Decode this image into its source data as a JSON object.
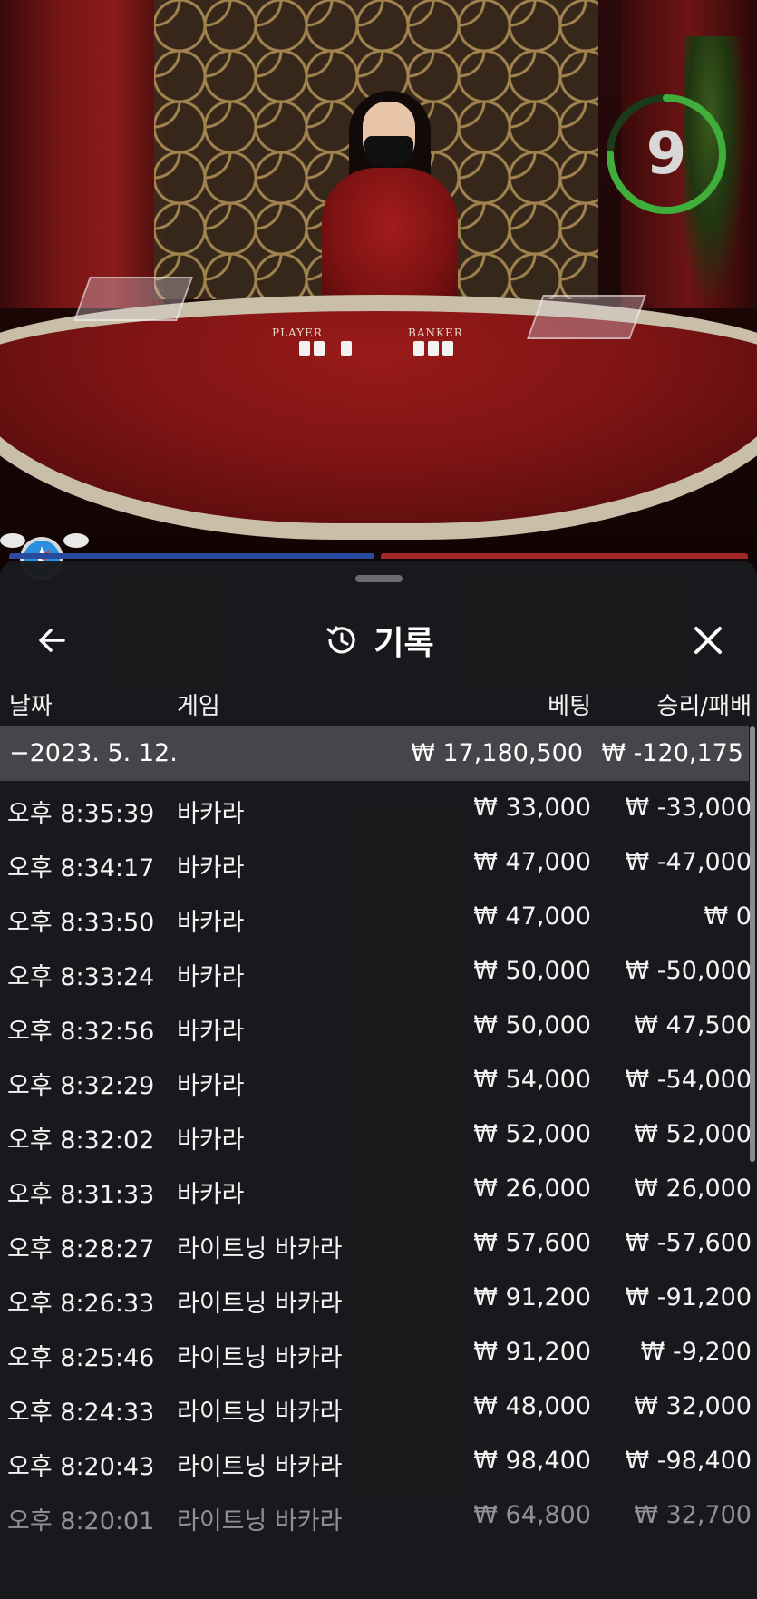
{
  "timer": {
    "value": "9",
    "fraction_remaining": 0.75,
    "color": "#3fae3a"
  },
  "table_labels": {
    "player": "PLAYER",
    "banker": "BANKER"
  },
  "header": {
    "title": "기록",
    "history_icon": "history-icon",
    "back_icon": "arrow-left-icon",
    "close_icon": "close-icon"
  },
  "columns": {
    "date": "날짜",
    "game": "게임",
    "bet": "베팅",
    "result": "승리/패배"
  },
  "summary": {
    "date": "−2023. 5. 12.",
    "bet": "₩ 17,180,500",
    "result": "₩ -120,175"
  },
  "rows": [
    {
      "time": "오후 8:35:39",
      "game": "바카라",
      "bet": "₩ 33,000",
      "result": "₩ -33,000"
    },
    {
      "time": "오후 8:34:17",
      "game": "바카라",
      "bet": "₩ 47,000",
      "result": "₩ -47,000"
    },
    {
      "time": "오후 8:33:50",
      "game": "바카라",
      "bet": "₩ 47,000",
      "result": "₩ 0"
    },
    {
      "time": "오후 8:33:24",
      "game": "바카라",
      "bet": "₩ 50,000",
      "result": "₩ -50,000"
    },
    {
      "time": "오후 8:32:56",
      "game": "바카라",
      "bet": "₩ 50,000",
      "result": "₩ 47,500"
    },
    {
      "time": "오후 8:32:29",
      "game": "바카라",
      "bet": "₩ 54,000",
      "result": "₩ -54,000"
    },
    {
      "time": "오후 8:32:02",
      "game": "바카라",
      "bet": "₩ 52,000",
      "result": "₩ 52,000"
    },
    {
      "time": "오후 8:31:33",
      "game": "바카라",
      "bet": "₩ 26,000",
      "result": "₩ 26,000"
    },
    {
      "time": "오후 8:28:27",
      "game": "라이트닝 바카라",
      "bet": "₩ 57,600",
      "result": "₩ -57,600"
    },
    {
      "time": "오후 8:26:33",
      "game": "라이트닝 바카라",
      "bet": "₩ 91,200",
      "result": "₩ -91,200"
    },
    {
      "time": "오후 8:25:46",
      "game": "라이트닝 바카라",
      "bet": "₩ 91,200",
      "result": "₩ -9,200"
    },
    {
      "time": "오후 8:24:33",
      "game": "라이트닝 바카라",
      "bet": "₩ 48,000",
      "result": "₩ 32,000"
    },
    {
      "time": "오후 8:20:43",
      "game": "라이트닝 바카라",
      "bet": "₩ 98,400",
      "result": "₩ -98,400"
    },
    {
      "time": "오후 8:20:01",
      "game": "라이트닝 바카라",
      "bet": "₩ 64,800",
      "result": "₩ 32,700"
    }
  ]
}
